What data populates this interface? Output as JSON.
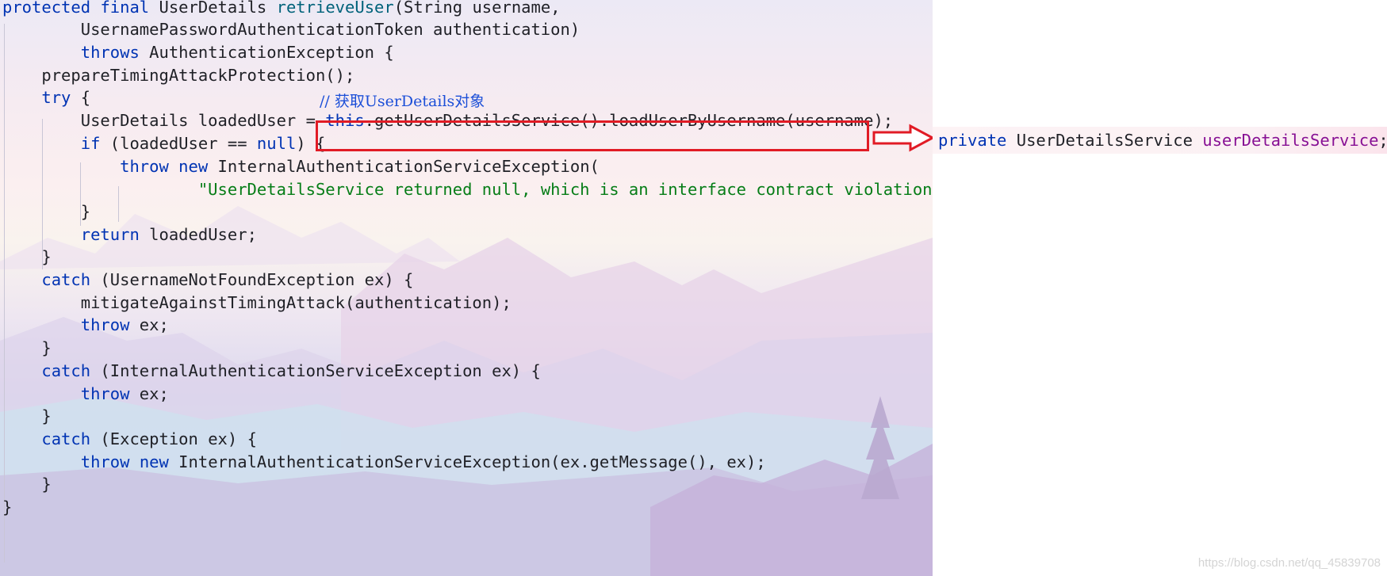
{
  "code": {
    "lines": [
      [
        {
          "t": "protected",
          "c": "kw"
        },
        {
          "t": " "
        },
        {
          "t": "final",
          "c": "kw"
        },
        {
          "t": " UserDetails "
        },
        {
          "t": "retrieveUser",
          "c": "fn"
        },
        {
          "t": "(String username,"
        }
      ],
      [
        {
          "t": "        UsernamePasswordAuthenticationToken authentication)"
        }
      ],
      [
        {
          "t": "        "
        },
        {
          "t": "throws",
          "c": "kw"
        },
        {
          "t": " AuthenticationException {"
        }
      ],
      [
        {
          "t": "    prepareTimingAttackProtection();"
        }
      ],
      [
        {
          "t": "    "
        },
        {
          "t": "try",
          "c": "kw"
        },
        {
          "t": " {"
        }
      ],
      [
        {
          "t": "        UserDetails loadedUser = "
        },
        {
          "t": "this",
          "c": "kw"
        },
        {
          "t": ".getUserDetailsService().loadUserByUsername(username);"
        }
      ],
      [
        {
          "t": "        "
        },
        {
          "t": "if",
          "c": "kw"
        },
        {
          "t": " (loadedUser == "
        },
        {
          "t": "null",
          "c": "kw"
        },
        {
          "t": ") {"
        }
      ],
      [
        {
          "t": "            "
        },
        {
          "t": "throw",
          "c": "kw"
        },
        {
          "t": " "
        },
        {
          "t": "new",
          "c": "kw"
        },
        {
          "t": " InternalAuthenticationServiceException("
        }
      ],
      [
        {
          "t": "                    "
        },
        {
          "t": "\"UserDetailsService returned null, which is an interface contract violation\"",
          "c": "str"
        },
        {
          "t": ");"
        }
      ],
      [
        {
          "t": "        }"
        }
      ],
      [
        {
          "t": "        "
        },
        {
          "t": "return",
          "c": "kw"
        },
        {
          "t": " loadedUser;"
        }
      ],
      [
        {
          "t": "    }"
        }
      ],
      [
        {
          "t": "    "
        },
        {
          "t": "catch",
          "c": "kw"
        },
        {
          "t": " (UsernameNotFoundException ex) {"
        }
      ],
      [
        {
          "t": "        mitigateAgainstTimingAttack(authentication);"
        }
      ],
      [
        {
          "t": "        "
        },
        {
          "t": "throw",
          "c": "kw"
        },
        {
          "t": " ex;"
        }
      ],
      [
        {
          "t": "    }"
        }
      ],
      [
        {
          "t": "    "
        },
        {
          "t": "catch",
          "c": "kw"
        },
        {
          "t": " (InternalAuthenticationServiceException ex) {"
        }
      ],
      [
        {
          "t": "        "
        },
        {
          "t": "throw",
          "c": "kw"
        },
        {
          "t": " ex;"
        }
      ],
      [
        {
          "t": "    }"
        }
      ],
      [
        {
          "t": "    "
        },
        {
          "t": "catch",
          "c": "kw"
        },
        {
          "t": " (Exception ex) {"
        }
      ],
      [
        {
          "t": "        "
        },
        {
          "t": "throw",
          "c": "kw"
        },
        {
          "t": " "
        },
        {
          "t": "new",
          "c": "kw"
        },
        {
          "t": " InternalAuthenticationServiceException(ex.getMessage(), ex);"
        }
      ],
      [
        {
          "t": "    }"
        }
      ],
      [
        {
          "t": "}"
        }
      ]
    ],
    "comment": "// 获取UserDetails对象"
  },
  "field_line": [
    {
      "t": "private",
      "c": "kw"
    },
    {
      "t": " UserDetailsService "
    },
    {
      "t": "userDetailsService",
      "c": "fld"
    },
    {
      "t": ";"
    }
  ],
  "watermark": "https://blog.csdn.net/qq_45839708",
  "colors": {
    "keyword": "#0033b3",
    "method": "#00627a",
    "string": "#067d17",
    "field": "#871094",
    "comment": "#1c4fd8",
    "highlight": "#e11b25"
  },
  "icons": {
    "pointer": "red-outline-arrow"
  }
}
